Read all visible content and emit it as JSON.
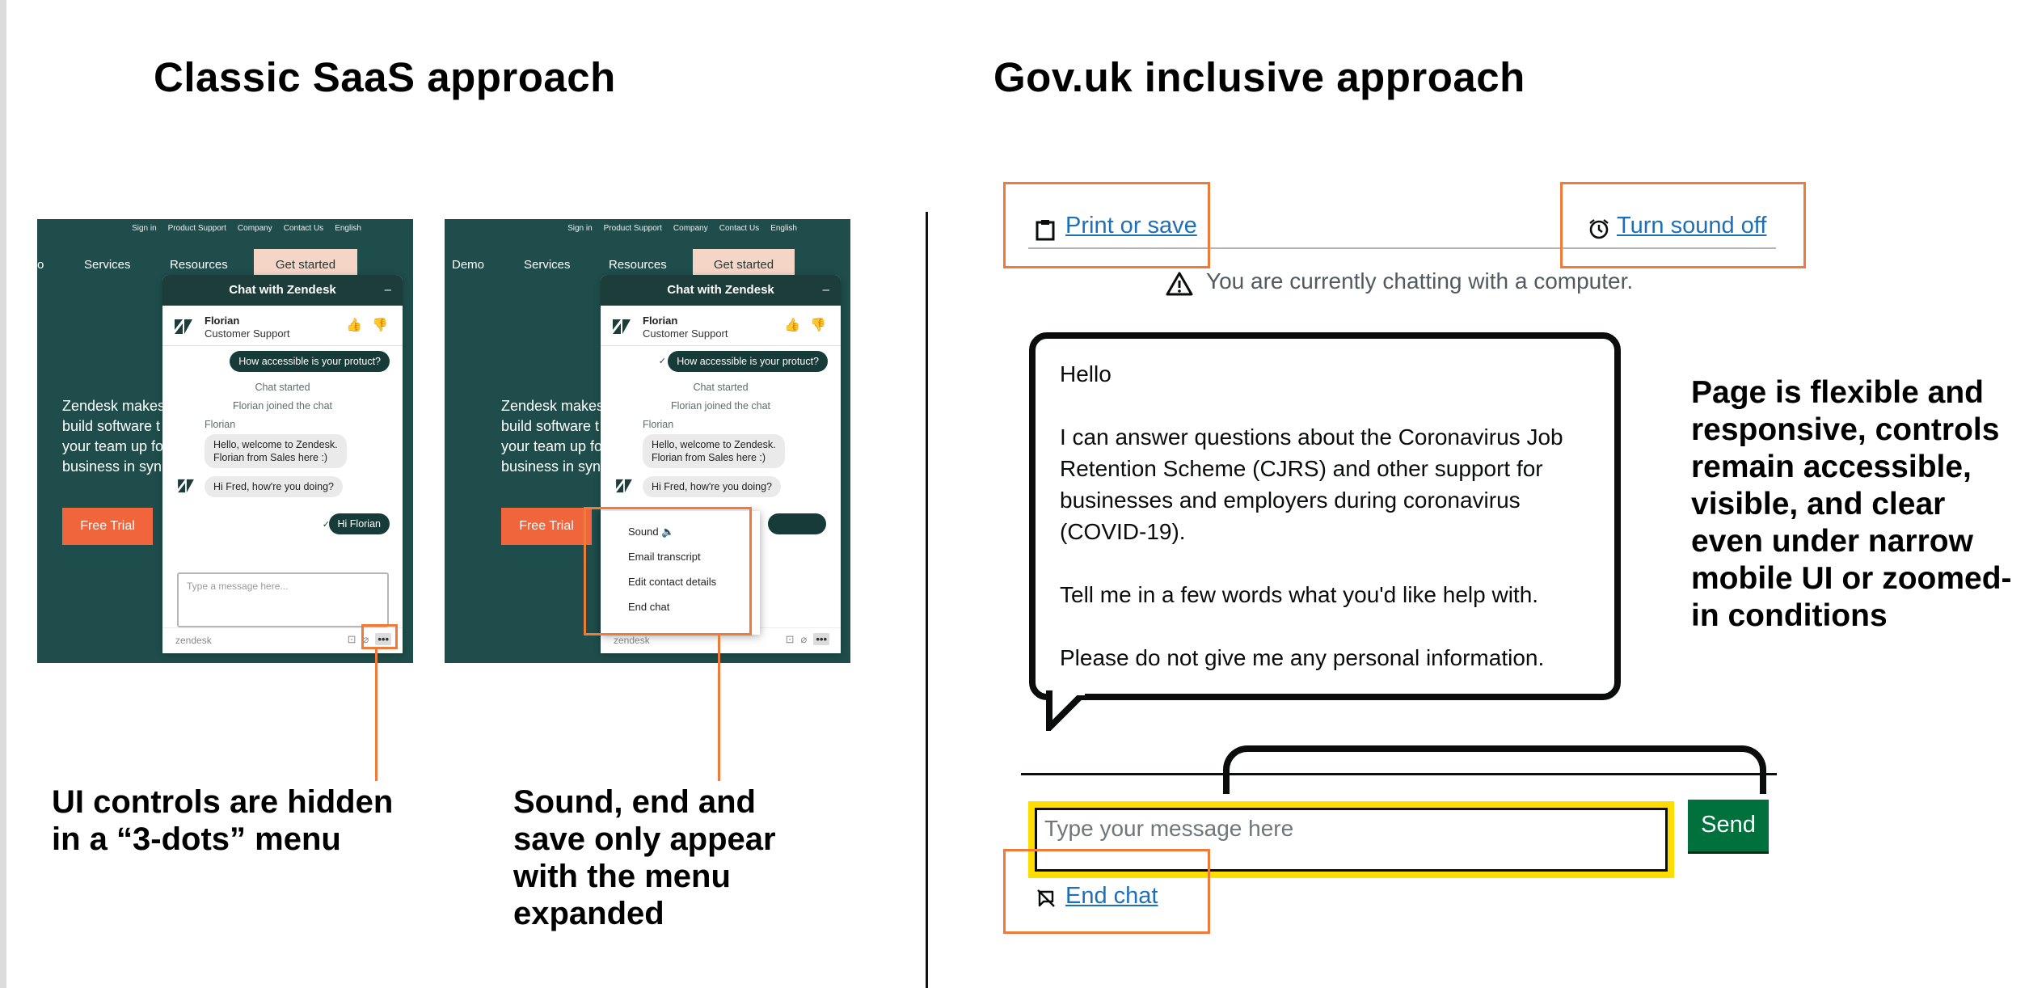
{
  "titles": {
    "left": "Classic SaaS approach",
    "right": "Gov.uk inclusive approach"
  },
  "saas": {
    "topnav": [
      "Sign in",
      "Product Support",
      "Company",
      "Contact Us",
      "English"
    ],
    "nav": {
      "demo": "Demo",
      "o": "o",
      "services": "Services",
      "resources": "Resources",
      "get_started": "Get started"
    },
    "hero_lines": [
      "Zendesk makes",
      "build software t",
      "your team up fo",
      "business in sync"
    ],
    "hero_lines_b": [
      "Zendesk makes",
      "build software t",
      "your team up fo",
      "business in sync"
    ],
    "trial": "Free Trial",
    "widget": {
      "title": "Chat with Zendesk",
      "minimize": "–",
      "agent_name": "Florian",
      "agent_role": "Customer Support",
      "q1": "How accessible is your protuct?",
      "sys1": "Chat started",
      "sys2": "Florian joined the chat",
      "from": "Florian",
      "msg1a": "Hello, welcome to Zendesk.",
      "msg1b": "Florian from Sales here :)",
      "msg2": "Hi Fred, how're you doing?",
      "reply": "Hi Florian",
      "placeholder": "Type a message here...",
      "footer": "zendesk",
      "dots": "•••"
    },
    "menu": [
      "Sound 🔈",
      "Email transcript",
      "Edit contact details",
      "End chat"
    ],
    "caption_left": [
      "UI controls are hidden",
      "in a “3-dots” menu"
    ],
    "caption_mid": [
      "Sound, end and",
      "save only appear",
      "with the menu",
      "expanded"
    ]
  },
  "gov": {
    "print": "Print or save",
    "sound": "Turn sound off",
    "notice": "You are currently chatting with a computer.",
    "bot": [
      "Hello",
      "I can answer questions about the Coronavirus Job Retention Scheme (CJRS) and other support for businesses and employers during coronavirus (COVID-19).",
      "Tell me in a few words what you'd like help with.",
      "Please do not give me any personal information."
    ],
    "input_placeholder": "Type your message here",
    "send": "Send",
    "end_chat": "End chat",
    "note": [
      "Page is flexible and",
      "responsive, controls",
      "remain accessible,",
      "visible, and clear",
      "even under narrow",
      "mobile UI or zoomed-",
      "in conditions"
    ]
  },
  "colors": {
    "annotation": "#f07a3a",
    "zendesk_green": "#1f4d4b",
    "link": "#1d70b8",
    "send": "#00703c",
    "focus": "#ffdd00"
  }
}
